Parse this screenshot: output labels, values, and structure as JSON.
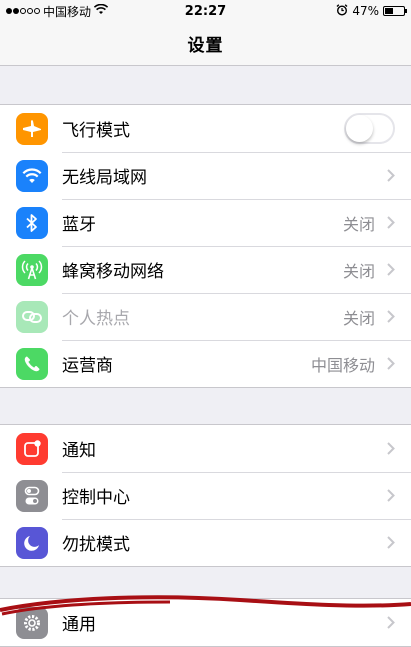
{
  "status_bar": {
    "carrier": "中国移动",
    "time": "22:27",
    "battery_percent": "47%",
    "battery_level": 0.47,
    "signal_bars_filled": 2,
    "signal_bars_total": 5
  },
  "nav": {
    "title": "设置"
  },
  "group1": {
    "items": [
      {
        "label": "飞行模式",
        "icon": "airplane-icon",
        "color": "#ff9500",
        "control": "toggle",
        "toggle_on": false
      },
      {
        "label": "无线局域网",
        "icon": "wifi-icon",
        "color": "#1a82fb",
        "value": ""
      },
      {
        "label": "蓝牙",
        "icon": "bluetooth-icon",
        "color": "#1a82fb",
        "value": "关闭"
      },
      {
        "label": "蜂窝移动网络",
        "icon": "cellular-icon",
        "color": "#4cd964",
        "value": "关闭"
      },
      {
        "label": "个人热点",
        "icon": "hotspot-icon",
        "color": "#a8e8b8",
        "value": "关闭",
        "disabled": true
      },
      {
        "label": "运营商",
        "icon": "phone-icon",
        "color": "#4cd964",
        "value": "中国移动"
      }
    ]
  },
  "group2": {
    "items": [
      {
        "label": "通知",
        "icon": "notification-icon",
        "color": "#ff3b30"
      },
      {
        "label": "控制中心",
        "icon": "control-center-icon",
        "color": "#8e8e93"
      },
      {
        "label": "勿扰模式",
        "icon": "moon-icon",
        "color": "#5856d6"
      }
    ]
  },
  "group3": {
    "items": [
      {
        "label": "通用",
        "icon": "gear-icon",
        "color": "#8e8e93"
      }
    ]
  }
}
